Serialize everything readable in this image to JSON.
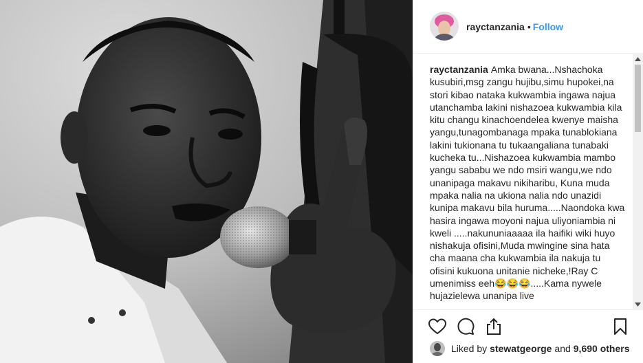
{
  "post": {
    "username": "rayctanzania",
    "separator": "•",
    "follow_label": "Follow",
    "caption_username": "rayctanzania",
    "caption_text": "Amka bwana...Nshachoka kusubiri,msg zangu hujibu,simu hupokei,na stori kibao nataka kukwambia ingawa najua utanchamba lakini nishazoea kukwambia kila kitu changu kinachoendelea kwenye maisha yangu,tunagombanaga mpaka tunablokiana lakini tukionana tu tukaangaliana tunabaki kucheka tu...Nishazoea kukwambia mambo yangu sababu we ndo msiri wangu,we ndo unanipaga makavu nikiharibu, Kuna muda mpaka nalia na ukiona nalia ndo unazidi kunipa makavu bila huruma.....Naondoka kwa hasira ingawa moyoni najua uliyoniambia ni kweli .....nakununiaaaaa ila haifiki wiki huyo nishakuja ofisini,Muda mwingine sina hata cha maana cha kukwambia ila nakuja tu ofisini kukuona unitanie nicheke,!Ray C umenimiss eeh😂😂😂.....Kama nywele hujazielewa unanipa live"
  },
  "likes": {
    "prefix": "Liked by",
    "user": "stewatgeorge",
    "and": "and",
    "count": "9,690 others"
  },
  "icons": {
    "like": "heart-icon",
    "comment": "comment-icon",
    "share": "share-icon",
    "save": "bookmark-icon"
  },
  "colors": {
    "link": "#3897f0",
    "text": "#262626",
    "border": "#efefef"
  }
}
